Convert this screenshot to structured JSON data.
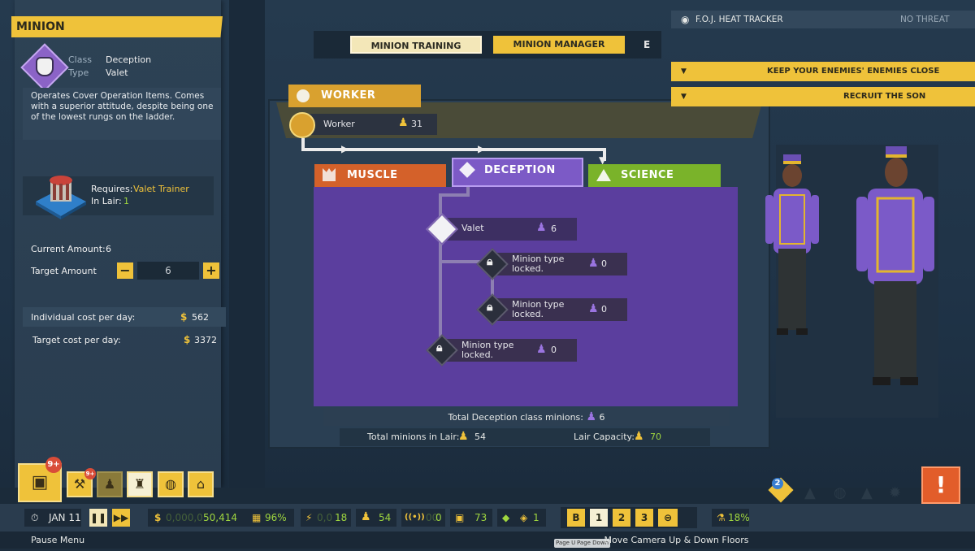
{
  "minion_panel": {
    "header": "MINION",
    "class_label": "Class",
    "class_value": "Deception",
    "type_label": "Type",
    "type_value": "Valet",
    "description_lines": [
      "Operates Cover Operation Items. Comes",
      "with a superior attitude, despite being one",
      "of the lowest rungs on the ladder."
    ],
    "requires_label": "Requires:",
    "requires_value": "Valet Trainer",
    "in_lair_label": "In Lair:",
    "in_lair_value": "1",
    "current_amount_label": "Current Amount:",
    "current_amount_value": "6",
    "target_amount_label": "Target Amount",
    "target_amount_value": "6",
    "minus_label": "−",
    "plus_label": "+",
    "individual_cost_label": "Individual cost per day:",
    "individual_cost_value": "562",
    "target_cost_label": "Target cost per day:",
    "target_cost_value": "3372",
    "currency_symbol": "$"
  },
  "tabs": {
    "training": "MINION TRAINING",
    "manager": "MINION MANAGER",
    "key_hint": "E"
  },
  "tree": {
    "worker_tag": "WORKER",
    "worker_node": {
      "label": "Worker",
      "count": "31"
    },
    "categories": {
      "muscle": "MUSCLE",
      "deception": "DECEPTION",
      "science": "SCIENCE"
    },
    "valet_node": {
      "label": "Valet",
      "count": "6"
    },
    "locked_nodes": [
      {
        "line1": "Minion type",
        "line2": "locked.",
        "count": "0"
      },
      {
        "line1": "Minion type",
        "line2": "locked.",
        "count": "0"
      },
      {
        "line1": "Minion type",
        "line2": "locked.",
        "count": "0"
      }
    ],
    "total_class_label": "Total Deception class minions:",
    "total_class_value": "6",
    "total_lair_label": "Total minions in Lair:",
    "total_lair_value": "54",
    "capacity_label": "Lair Capacity:",
    "capacity_value": "70"
  },
  "right_panel": {
    "heat_tracker_label": "F.O.J. HEAT TRACKER",
    "heat_tracker_status": "NO THREAT",
    "objectives": [
      "KEEP YOUR ENEMIES' ENEMIES CLOSE",
      "RECRUIT THE SON"
    ]
  },
  "hud": {
    "date": "JAN 11",
    "money_dim": "0,000,0",
    "money": "50,414",
    "percent_1": "96%",
    "power_dim": "0,0",
    "power": "18",
    "minions": "54",
    "signal_dim": "00",
    "signal": "0",
    "fuel": "73",
    "shield": "1",
    "floors": [
      "B",
      "1",
      "2",
      "3"
    ],
    "science_pct": "18%",
    "notifications_badge": "9+",
    "tool_badge": "9+",
    "alert_badge": "2",
    "pause_menu": "Pause Menu",
    "page_up_key": "Page Up",
    "page_down_key": "Page Down",
    "camera_hint": "- Move Camera Up & Down Floors"
  },
  "colors": {
    "accent_yellow": "#efc23a",
    "deception_purple": "#5b3e9e",
    "muscle_orange": "#d4612a",
    "science_green": "#7ab32a",
    "status_green": "#9fd63f"
  }
}
